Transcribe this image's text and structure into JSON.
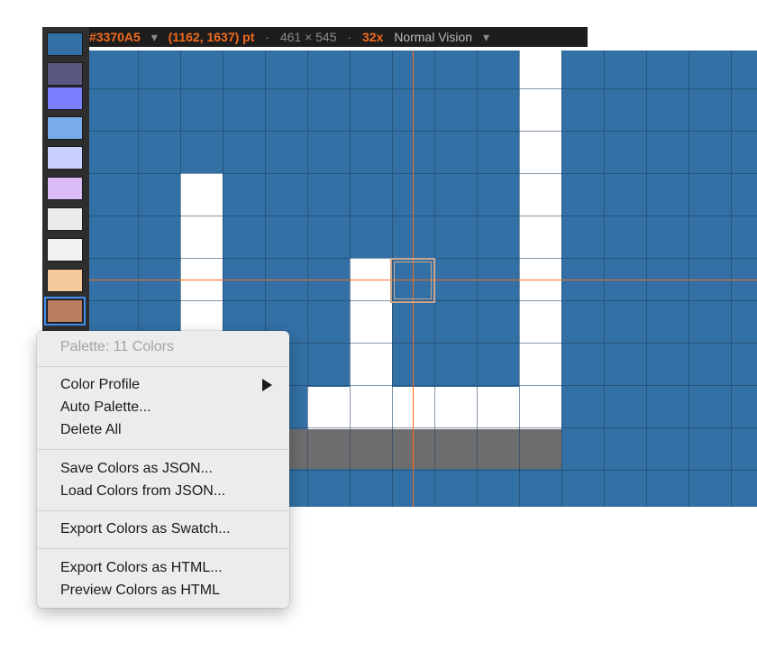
{
  "info_bar": {
    "hex": "#3370A5",
    "coords": "(1162, 1637) pt",
    "size": "461 × 545",
    "zoom": "32x",
    "mode": "Normal Vision"
  },
  "palette": {
    "swatches": [
      {
        "name": "swatch-1",
        "color": "#3370a5"
      },
      {
        "name": "swatch-2",
        "color": "#58577f"
      },
      {
        "name": "swatch-3",
        "color": "#7a80ff"
      },
      {
        "name": "swatch-4",
        "color": "#77ace9"
      },
      {
        "name": "swatch-5",
        "color": "#c8d1ff"
      },
      {
        "name": "swatch-6",
        "color": "#dcbcf6"
      },
      {
        "name": "swatch-7",
        "color": "#ebebeb"
      },
      {
        "name": "swatch-8",
        "color": "#f2f2f2"
      },
      {
        "name": "swatch-9",
        "color": "#f6c99a"
      },
      {
        "name": "swatch-10",
        "color": "#bb7e63"
      }
    ]
  },
  "canvas": {
    "background": "#3370a5",
    "crosshair_color": "#ff6a1a"
  },
  "menu": {
    "header": "Palette: 11 Colors",
    "items": [
      {
        "label": "Color Profile",
        "submenu": true
      },
      {
        "label": "Auto Palette..."
      },
      {
        "label": "Delete All"
      },
      {
        "label": "Save Colors as JSON..."
      },
      {
        "label": "Load Colors from JSON..."
      },
      {
        "label": "Export Colors as Swatch..."
      },
      {
        "label": "Export Colors as HTML..."
      },
      {
        "label": "Preview Colors as HTML"
      }
    ]
  }
}
